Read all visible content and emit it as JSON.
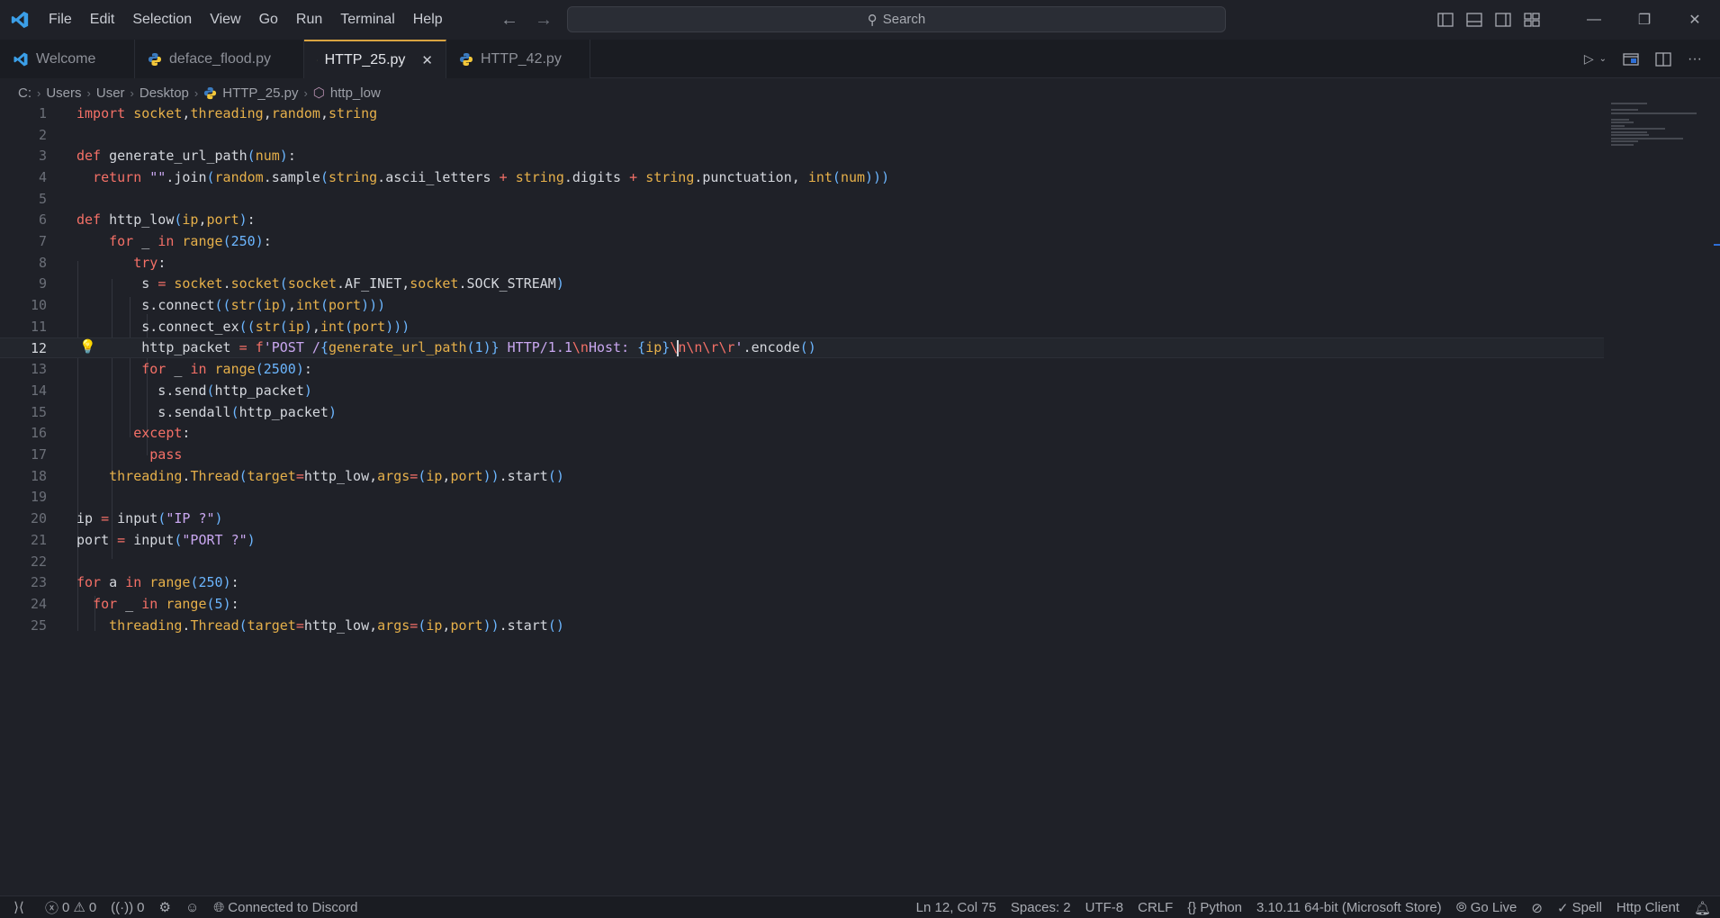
{
  "menu": [
    "File",
    "Edit",
    "Selection",
    "View",
    "Go",
    "Run",
    "Terminal",
    "Help"
  ],
  "search": {
    "placeholder": "Search"
  },
  "tabs": [
    {
      "label": "Welcome",
      "icon": "vscode-icon"
    },
    {
      "label": "deface_flood.py",
      "icon": "python-icon"
    },
    {
      "label": "HTTP_25.py",
      "icon": "python-icon",
      "active": true
    },
    {
      "label": "HTTP_42.py",
      "icon": "python-icon"
    }
  ],
  "breadcrumb": {
    "drive": "C:",
    "users": "Users",
    "user": "User",
    "desktop": "Desktop",
    "file": "HTTP_25.py",
    "symbol": "http_low"
  },
  "code": {
    "line_numbers": [
      "1",
      "2",
      "3",
      "4",
      "5",
      "6",
      "7",
      "8",
      "9",
      "10",
      "11",
      "12",
      "13",
      "14",
      "15",
      "16",
      "17",
      "18",
      "19",
      "20",
      "21",
      "22",
      "23",
      "24",
      "25"
    ],
    "current_line": 12
  },
  "status": {
    "errors": "0",
    "warnings": "0",
    "ports": "0",
    "discord": "Connected to Discord",
    "position": "Ln 12, Col 75",
    "spaces": "Spaces: 2",
    "encoding": "UTF-8",
    "eol": "CRLF",
    "language": "Python",
    "interpreter": "3.10.11 64-bit (Microsoft Store)",
    "golive": "Go Live",
    "spell": "Spell",
    "httpclient": "Http Client"
  },
  "colors": {
    "accent_tab": "#d9a441",
    "background": "#1f2128",
    "keyword": "#f47067",
    "function": "#e6b04a"
  }
}
